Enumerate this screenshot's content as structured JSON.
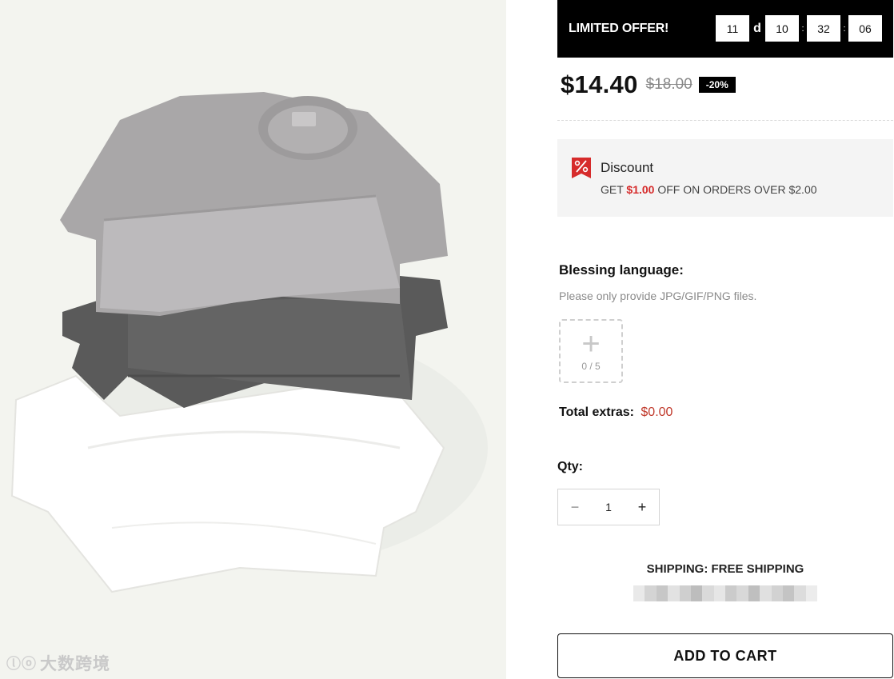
{
  "offer": {
    "title": "LIMITED OFFER!",
    "days": "11",
    "days_suffix": "d",
    "hours": "10",
    "minutes": "32",
    "seconds": "06",
    "separator": ":"
  },
  "pricing": {
    "price": "$14.40",
    "old_price": "$18.00",
    "discount_badge": "-20%"
  },
  "discount": {
    "icon": "percent-tag-icon",
    "title": "Discount",
    "desc_prefix": "GET",
    "desc_amount": "$1.00",
    "desc_suffix": "OFF ON ORDERS OVER $2.00"
  },
  "blessing": {
    "label": "Blessing language:",
    "hint": "Please only provide JPG/GIF/PNG files.",
    "upload_icon": "plus-icon",
    "upload_count": "0 / 5"
  },
  "extras": {
    "label": "Total extras:",
    "value": "$0.00"
  },
  "quantity": {
    "label": "Qty:",
    "value": "1",
    "minus": "−",
    "plus": "+"
  },
  "shipping": {
    "text": "SHIPPING: FREE SHIPPING"
  },
  "cart": {
    "button_label": "ADD TO CART"
  },
  "watermark": {
    "logo": "ⓛⓞ",
    "text": "大数跨境"
  },
  "colors": {
    "accent_red": "#d62b2b",
    "offer_bar": "#000000",
    "panel_bg": "#f4f4f4"
  }
}
